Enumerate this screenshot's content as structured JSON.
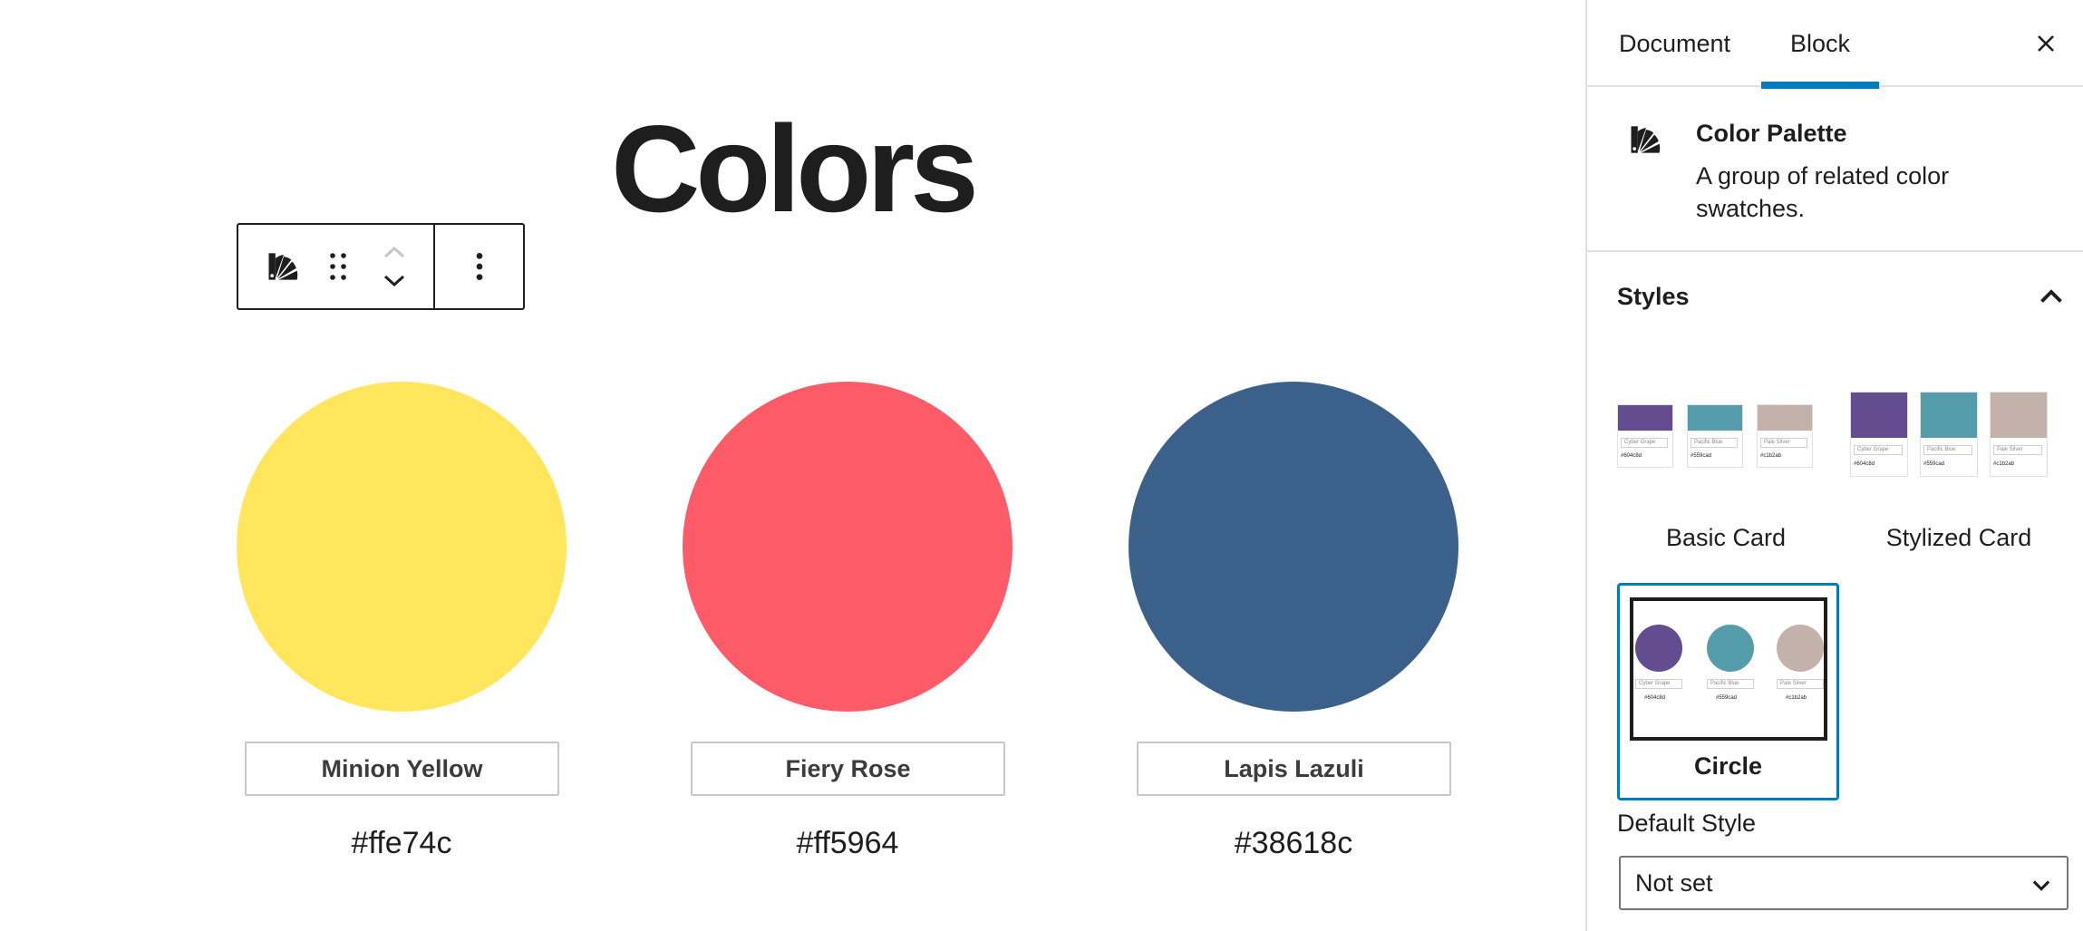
{
  "canvas": {
    "title": "Colors",
    "toolbar": {
      "block_icon": "color-palette-icon",
      "drag_icon": "drag-handle-icon",
      "move_up_icon": "chevron-up-icon",
      "move_down_icon": "chevron-down-icon",
      "more_icon": "more-vertical-icon"
    },
    "swatches": [
      {
        "name": "Minion Yellow",
        "hex": "#ffe74c",
        "color": "#ffe65c"
      },
      {
        "name": "Fiery Rose",
        "hex": "#ff5964",
        "color": "#fd5b68"
      },
      {
        "name": "Lapis Lazuli",
        "hex": "#38618c",
        "color": "#3b618b"
      }
    ]
  },
  "sidebar": {
    "tabs": [
      {
        "label": "Document",
        "active": false
      },
      {
        "label": "Block",
        "active": true
      }
    ],
    "close_icon": "close-icon",
    "block_card": {
      "icon": "color-palette-icon",
      "title": "Color Palette",
      "description": "A group of related color swatches."
    },
    "styles": {
      "title": "Styles",
      "toggle_icon": "chevron-up-icon",
      "options": [
        {
          "label": "Basic Card",
          "selected": false
        },
        {
          "label": "Stylized Card",
          "selected": false
        },
        {
          "label": "Circle",
          "selected": true
        }
      ],
      "preview": {
        "colors": [
          {
            "name": "Cyber Grape",
            "hex": "#604c8d",
            "color": "#634d90"
          },
          {
            "name": "Pacific Blue",
            "hex": "#559cad",
            "color": "#569dab"
          },
          {
            "name": "Pale Silver",
            "hex": "#c1b2ab",
            "color": "#c2b2aa"
          }
        ]
      }
    },
    "default_style": {
      "label": "Default Style",
      "value": "Not set",
      "chevron_icon": "chevron-down-icon"
    }
  },
  "colors": {
    "accent": "#007cba",
    "text": "#1e1e1e",
    "border": "#e0e0e0"
  }
}
